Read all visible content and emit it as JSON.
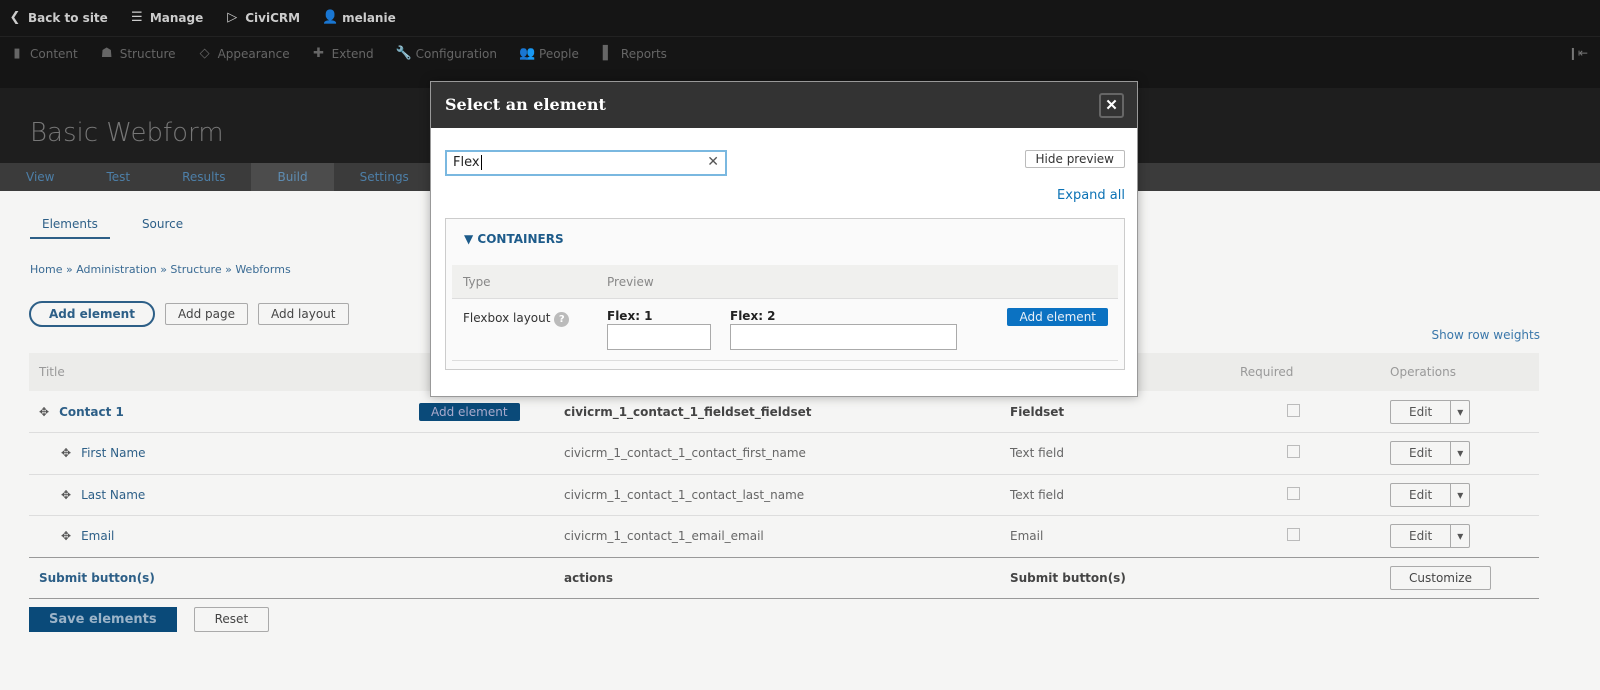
{
  "toolbar": {
    "items": [
      {
        "icon": "chevron-left-circle-icon",
        "label": "Back to site"
      },
      {
        "icon": "menu-icon",
        "label": "Manage"
      },
      {
        "icon": "civicrm-icon",
        "label": "CiviCRM"
      },
      {
        "icon": "user-icon",
        "label": "melanie"
      }
    ],
    "menu": [
      {
        "icon": "file-icon",
        "label": "Content"
      },
      {
        "icon": "sitemap-icon",
        "label": "Structure"
      },
      {
        "icon": "brush-icon",
        "label": "Appearance"
      },
      {
        "icon": "puzzle-icon",
        "label": "Extend"
      },
      {
        "icon": "wrench-icon",
        "label": "Configuration"
      },
      {
        "icon": "people-icon",
        "label": "People"
      },
      {
        "icon": "bar-chart-icon",
        "label": "Reports"
      }
    ]
  },
  "page": {
    "title": "Basic Webform",
    "tabs": [
      "View",
      "Test",
      "Results",
      "Build",
      "Settings"
    ],
    "active_tab": "Build",
    "subtabs": [
      "Elements",
      "Source"
    ],
    "breadcrumb": "Home » Administration » Structure » Webforms",
    "actions": {
      "add_element": "Add element",
      "add_page": "Add page",
      "add_layout": "Add layout"
    },
    "show_row_weights": "Show row weights",
    "table": {
      "headers": {
        "title": "Title",
        "required": "Required",
        "operations": "Operations"
      },
      "rows": [
        {
          "title": "Contact 1",
          "add": "Add element",
          "key": "civicrm_1_contact_1_fieldset_fieldset",
          "type": "Fieldset",
          "op": "Edit"
        },
        {
          "title": "First Name",
          "key": "civicrm_1_contact_1_contact_first_name",
          "type": "Text field",
          "op": "Edit"
        },
        {
          "title": "Last Name",
          "key": "civicrm_1_contact_1_contact_last_name",
          "type": "Text field",
          "op": "Edit"
        },
        {
          "title": "Email",
          "key": "civicrm_1_contact_1_email_email",
          "type": "Email",
          "op": "Edit"
        },
        {
          "title": "Submit button(s)",
          "key": "actions",
          "type": "Submit button(s)",
          "op": "Customize"
        }
      ]
    },
    "save": "Save elements",
    "reset": "Reset"
  },
  "modal": {
    "title": "Select an element",
    "search_value": "Flex",
    "hide_preview": "Hide preview",
    "expand_all": "Expand all",
    "group": "CONTAINERS",
    "columns": {
      "type": "Type",
      "preview": "Preview"
    },
    "item": {
      "type": "Flexbox layout",
      "flex1": "Flex: 1",
      "flex2": "Flex: 2",
      "add": "Add element"
    }
  }
}
